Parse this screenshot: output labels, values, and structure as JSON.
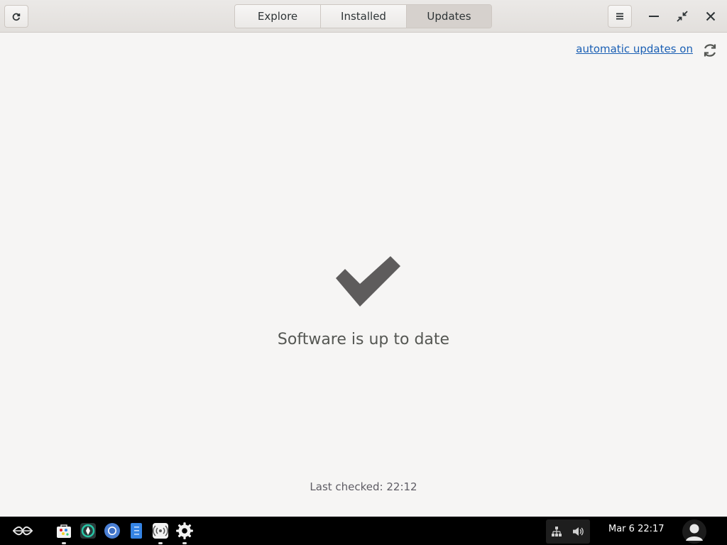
{
  "headerbar": {
    "tabs": [
      {
        "label": "Explore",
        "active": false
      },
      {
        "label": "Installed",
        "active": false
      },
      {
        "label": "Updates",
        "active": true
      }
    ],
    "icons": {
      "refresh": "refresh-icon",
      "menu": "hamburger-menu-icon",
      "minimize": "minimize-icon",
      "restore": "restore-icon",
      "close": "close-icon"
    }
  },
  "auto_updates": {
    "link_text": "automatic updates on",
    "icon": "sync-icon",
    "link_color": "#1a5fb4"
  },
  "status": {
    "icon": "checkmark-icon",
    "title": "Software is up to date",
    "last_checked": "Last checked: 22:12"
  },
  "taskbar": {
    "launcher_icon": "launcher-icon",
    "apps": [
      {
        "name": "software-store",
        "running": true
      },
      {
        "name": "flathub",
        "running": false
      },
      {
        "name": "chromium",
        "running": false
      },
      {
        "name": "notes",
        "running": false
      },
      {
        "name": "hotspot",
        "running": true
      },
      {
        "name": "settings",
        "running": true
      }
    ],
    "tray_icons": [
      "network-icon",
      "volume-icon"
    ],
    "clock": "Mar 6  22:17",
    "avatar_icon": "user-avatar-icon"
  }
}
